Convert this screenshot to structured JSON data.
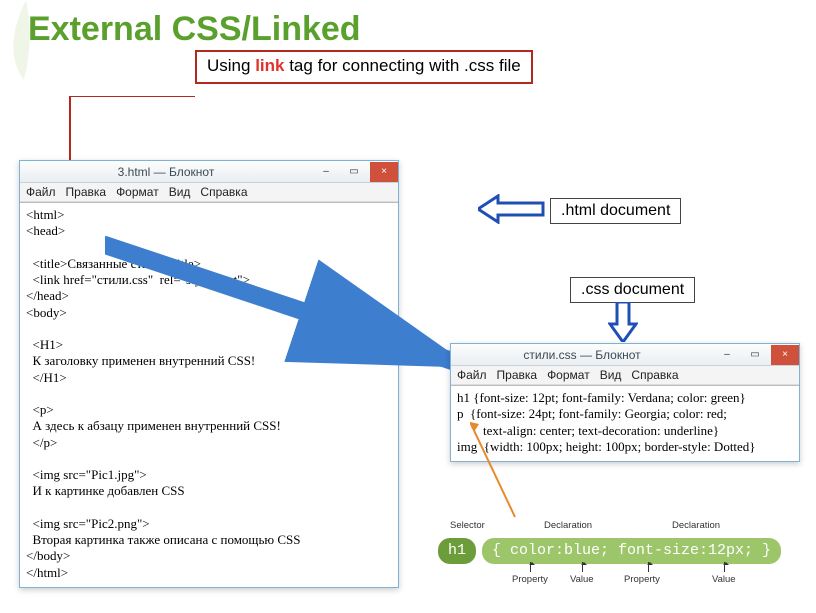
{
  "title": "External CSS/Linked",
  "callout": {
    "pre": "Using ",
    "hl": "link",
    "post": " tag for connecting with .css file"
  },
  "labels": {
    "html_doc": ".html document",
    "css_doc": ".css document"
  },
  "notepad": {
    "menu": [
      "Файл",
      "Правка",
      "Формат",
      "Вид",
      "Справка"
    ],
    "min": "–",
    "max": "▭",
    "close": "×"
  },
  "win1": {
    "title": "3.html — Блокнот",
    "body": "<html>\n<head>\n\n  <title>Связанные стили</title>\n  <link href=\"стили.css\"  rel=\"stylesheet\">\n</head>\n<body>\n\n  <H1>\n  К заголовку применен внутренний CSS!\n  </H1>\n\n  <p>\n  А здесь к абзацу применен внутренний CSS!\n  </p>\n\n  <img src=\"Pic1.jpg\">\n  И к картинке добавлен CSS\n\n  <img src=\"Pic2.png\">\n  Вторая картинка также описана с помощью CSS\n</body>\n</html>"
  },
  "win2": {
    "title": "стили.css — Блокнот",
    "body": "h1 {font-size: 12pt; font-family: Verdana; color: green}\np  {font-size: 24pt; font-family: Georgia; color: red;\n        text-align: center; text-decoration: underline}\nimg  {width: 100px; height: 100px; border-style: Dotted}"
  },
  "syntax": {
    "selector": "h1",
    "decl": "{ color:blue; font-size:12px; }",
    "top_labels": [
      "Selector",
      "Declaration",
      "Declaration"
    ],
    "bot_labels": [
      "Property",
      "Value",
      "Property",
      "Value"
    ]
  }
}
